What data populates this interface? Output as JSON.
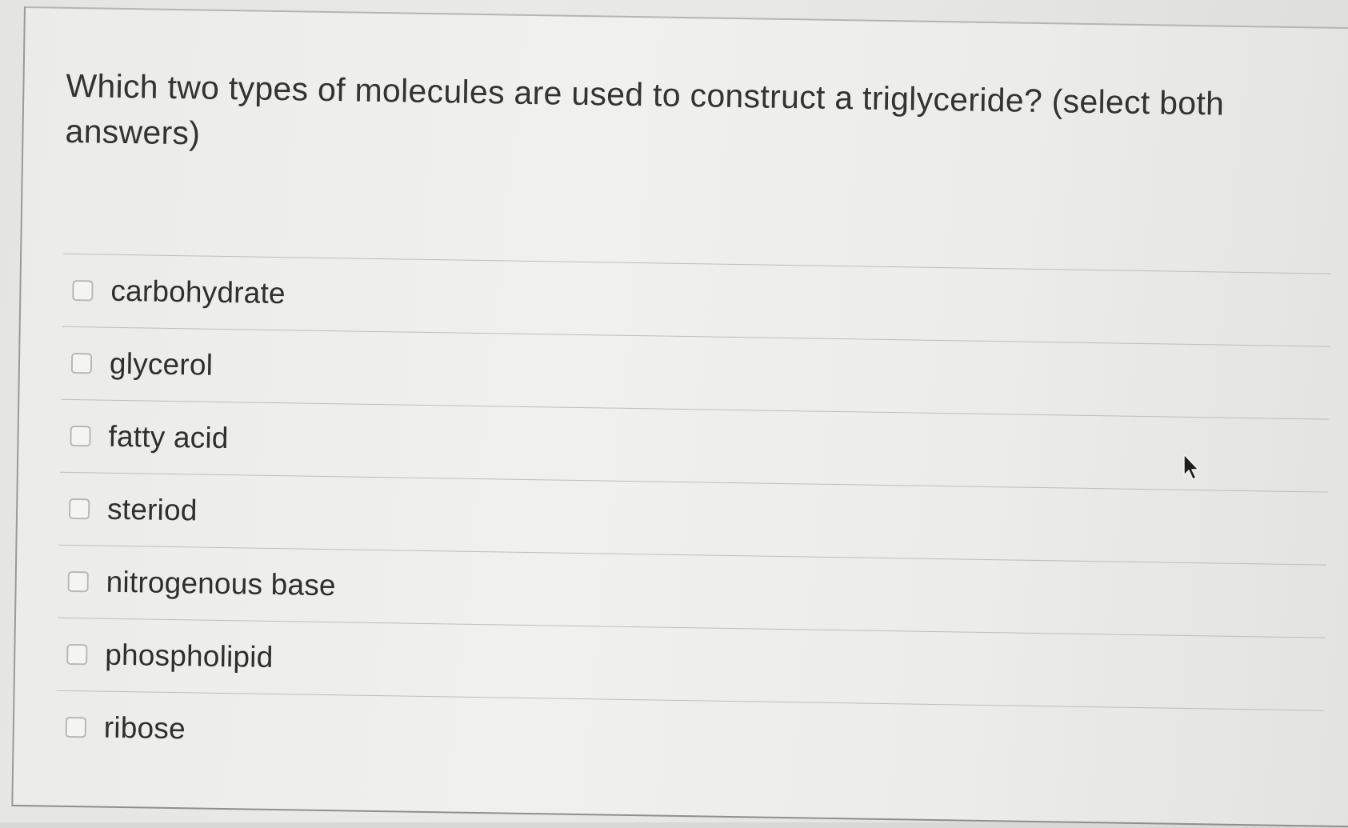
{
  "question": {
    "text": "Which two types of molecules are used to construct a triglyceride? (select both answers)"
  },
  "options": [
    {
      "label": "carbohydrate",
      "checked": false
    },
    {
      "label": "glycerol",
      "checked": false
    },
    {
      "label": "fatty acid",
      "checked": false
    },
    {
      "label": "steriod",
      "checked": false
    },
    {
      "label": "nitrogenous base",
      "checked": false
    },
    {
      "label": "phospholipid",
      "checked": false
    },
    {
      "label": "ribose",
      "checked": false
    }
  ],
  "icons": {
    "checkbox": "checkbox-icon",
    "cursor": "mouse-cursor-icon"
  },
  "colors": {
    "background": "#ececea",
    "text": "#2f2f2f",
    "divider": "#bdbdbb",
    "checkbox_border": "#b8b8b6"
  }
}
